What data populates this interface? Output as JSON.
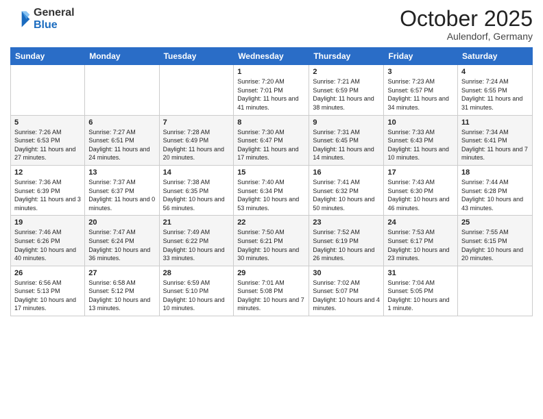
{
  "header": {
    "logo_general": "General",
    "logo_blue": "Blue",
    "month_title": "October 2025",
    "location": "Aulendorf, Germany"
  },
  "days_of_week": [
    "Sunday",
    "Monday",
    "Tuesday",
    "Wednesday",
    "Thursday",
    "Friday",
    "Saturday"
  ],
  "weeks": [
    [
      {
        "day": "",
        "sunrise": "",
        "sunset": "",
        "daylight": ""
      },
      {
        "day": "",
        "sunrise": "",
        "sunset": "",
        "daylight": ""
      },
      {
        "day": "",
        "sunrise": "",
        "sunset": "",
        "daylight": ""
      },
      {
        "day": "1",
        "sunrise": "Sunrise: 7:20 AM",
        "sunset": "Sunset: 7:01 PM",
        "daylight": "Daylight: 11 hours and 41 minutes."
      },
      {
        "day": "2",
        "sunrise": "Sunrise: 7:21 AM",
        "sunset": "Sunset: 6:59 PM",
        "daylight": "Daylight: 11 hours and 38 minutes."
      },
      {
        "day": "3",
        "sunrise": "Sunrise: 7:23 AM",
        "sunset": "Sunset: 6:57 PM",
        "daylight": "Daylight: 11 hours and 34 minutes."
      },
      {
        "day": "4",
        "sunrise": "Sunrise: 7:24 AM",
        "sunset": "Sunset: 6:55 PM",
        "daylight": "Daylight: 11 hours and 31 minutes."
      }
    ],
    [
      {
        "day": "5",
        "sunrise": "Sunrise: 7:26 AM",
        "sunset": "Sunset: 6:53 PM",
        "daylight": "Daylight: 11 hours and 27 minutes."
      },
      {
        "day": "6",
        "sunrise": "Sunrise: 7:27 AM",
        "sunset": "Sunset: 6:51 PM",
        "daylight": "Daylight: 11 hours and 24 minutes."
      },
      {
        "day": "7",
        "sunrise": "Sunrise: 7:28 AM",
        "sunset": "Sunset: 6:49 PM",
        "daylight": "Daylight: 11 hours and 20 minutes."
      },
      {
        "day": "8",
        "sunrise": "Sunrise: 7:30 AM",
        "sunset": "Sunset: 6:47 PM",
        "daylight": "Daylight: 11 hours and 17 minutes."
      },
      {
        "day": "9",
        "sunrise": "Sunrise: 7:31 AM",
        "sunset": "Sunset: 6:45 PM",
        "daylight": "Daylight: 11 hours and 14 minutes."
      },
      {
        "day": "10",
        "sunrise": "Sunrise: 7:33 AM",
        "sunset": "Sunset: 6:43 PM",
        "daylight": "Daylight: 11 hours and 10 minutes."
      },
      {
        "day": "11",
        "sunrise": "Sunrise: 7:34 AM",
        "sunset": "Sunset: 6:41 PM",
        "daylight": "Daylight: 11 hours and 7 minutes."
      }
    ],
    [
      {
        "day": "12",
        "sunrise": "Sunrise: 7:36 AM",
        "sunset": "Sunset: 6:39 PM",
        "daylight": "Daylight: 11 hours and 3 minutes."
      },
      {
        "day": "13",
        "sunrise": "Sunrise: 7:37 AM",
        "sunset": "Sunset: 6:37 PM",
        "daylight": "Daylight: 11 hours and 0 minutes."
      },
      {
        "day": "14",
        "sunrise": "Sunrise: 7:38 AM",
        "sunset": "Sunset: 6:35 PM",
        "daylight": "Daylight: 10 hours and 56 minutes."
      },
      {
        "day": "15",
        "sunrise": "Sunrise: 7:40 AM",
        "sunset": "Sunset: 6:34 PM",
        "daylight": "Daylight: 10 hours and 53 minutes."
      },
      {
        "day": "16",
        "sunrise": "Sunrise: 7:41 AM",
        "sunset": "Sunset: 6:32 PM",
        "daylight": "Daylight: 10 hours and 50 minutes."
      },
      {
        "day": "17",
        "sunrise": "Sunrise: 7:43 AM",
        "sunset": "Sunset: 6:30 PM",
        "daylight": "Daylight: 10 hours and 46 minutes."
      },
      {
        "day": "18",
        "sunrise": "Sunrise: 7:44 AM",
        "sunset": "Sunset: 6:28 PM",
        "daylight": "Daylight: 10 hours and 43 minutes."
      }
    ],
    [
      {
        "day": "19",
        "sunrise": "Sunrise: 7:46 AM",
        "sunset": "Sunset: 6:26 PM",
        "daylight": "Daylight: 10 hours and 40 minutes."
      },
      {
        "day": "20",
        "sunrise": "Sunrise: 7:47 AM",
        "sunset": "Sunset: 6:24 PM",
        "daylight": "Daylight: 10 hours and 36 minutes."
      },
      {
        "day": "21",
        "sunrise": "Sunrise: 7:49 AM",
        "sunset": "Sunset: 6:22 PM",
        "daylight": "Daylight: 10 hours and 33 minutes."
      },
      {
        "day": "22",
        "sunrise": "Sunrise: 7:50 AM",
        "sunset": "Sunset: 6:21 PM",
        "daylight": "Daylight: 10 hours and 30 minutes."
      },
      {
        "day": "23",
        "sunrise": "Sunrise: 7:52 AM",
        "sunset": "Sunset: 6:19 PM",
        "daylight": "Daylight: 10 hours and 26 minutes."
      },
      {
        "day": "24",
        "sunrise": "Sunrise: 7:53 AM",
        "sunset": "Sunset: 6:17 PM",
        "daylight": "Daylight: 10 hours and 23 minutes."
      },
      {
        "day": "25",
        "sunrise": "Sunrise: 7:55 AM",
        "sunset": "Sunset: 6:15 PM",
        "daylight": "Daylight: 10 hours and 20 minutes."
      }
    ],
    [
      {
        "day": "26",
        "sunrise": "Sunrise: 6:56 AM",
        "sunset": "Sunset: 5:13 PM",
        "daylight": "Daylight: 10 hours and 17 minutes."
      },
      {
        "day": "27",
        "sunrise": "Sunrise: 6:58 AM",
        "sunset": "Sunset: 5:12 PM",
        "daylight": "Daylight: 10 hours and 13 minutes."
      },
      {
        "day": "28",
        "sunrise": "Sunrise: 6:59 AM",
        "sunset": "Sunset: 5:10 PM",
        "daylight": "Daylight: 10 hours and 10 minutes."
      },
      {
        "day": "29",
        "sunrise": "Sunrise: 7:01 AM",
        "sunset": "Sunset: 5:08 PM",
        "daylight": "Daylight: 10 hours and 7 minutes."
      },
      {
        "day": "30",
        "sunrise": "Sunrise: 7:02 AM",
        "sunset": "Sunset: 5:07 PM",
        "daylight": "Daylight: 10 hours and 4 minutes."
      },
      {
        "day": "31",
        "sunrise": "Sunrise: 7:04 AM",
        "sunset": "Sunset: 5:05 PM",
        "daylight": "Daylight: 10 hours and 1 minute."
      },
      {
        "day": "",
        "sunrise": "",
        "sunset": "",
        "daylight": ""
      }
    ]
  ]
}
